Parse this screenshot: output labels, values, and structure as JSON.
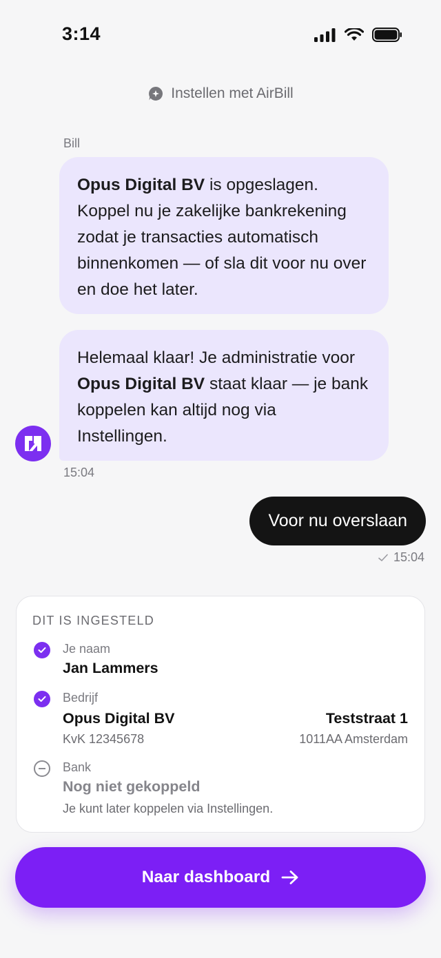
{
  "status_bar": {
    "time": "3:14"
  },
  "header": {
    "title": "Instellen met AirBill"
  },
  "chat": {
    "sender_name": "Bill",
    "bot_message_1": {
      "company": "Opus Digital BV",
      "text": " is opgeslagen. Koppel nu je zakelijke bankrekening zodat je transacties automatisch binnenkomen — of sla dit voor nu over en doe het later."
    },
    "bot_message_2": {
      "text_before": "Helemaal klaar! Je administratie voor ",
      "company": "Opus Digital BV",
      "text_after": " staat klaar — je bank koppelen kan altijd nog via Instellingen."
    },
    "bot_time": "15:04",
    "user_message": "Voor nu overslaan",
    "user_time": "15:04"
  },
  "summary": {
    "title": "DIT IS INGESTELD",
    "name": {
      "label": "Je naam",
      "value": "Jan Lammers"
    },
    "company": {
      "label": "Bedrijf",
      "value": "Opus Digital BV",
      "kvk": "KvK 12345678",
      "street": "Teststraat 1",
      "city": "1011AA Amsterdam"
    },
    "bank": {
      "label": "Bank",
      "value": "Nog niet gekoppeld",
      "note": "Je kunt later koppelen via Instellingen."
    }
  },
  "cta": {
    "label": "Naar dashboard"
  },
  "colors": {
    "accent": "#7c1ff5",
    "bubble": "#ebe6fd",
    "user_bubble": "#141414"
  }
}
